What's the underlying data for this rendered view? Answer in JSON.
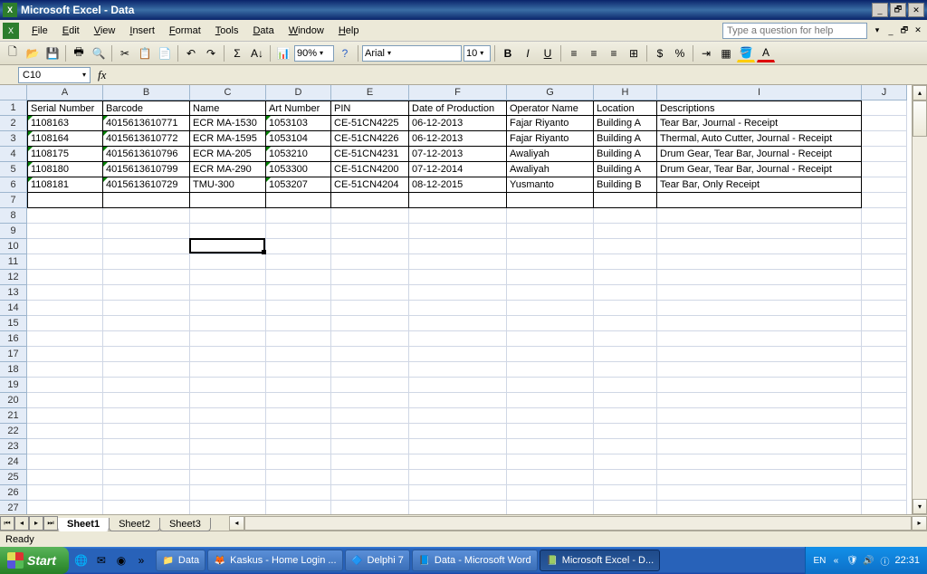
{
  "window": {
    "title": "Microsoft Excel - Data"
  },
  "menu": {
    "items": [
      "File",
      "Edit",
      "View",
      "Insert",
      "Format",
      "Tools",
      "Data",
      "Window",
      "Help"
    ],
    "help_placeholder": "Type a question for help"
  },
  "toolbar": {
    "zoom": "90%",
    "font": "Arial",
    "font_size": "10"
  },
  "namebox": {
    "value": "C10"
  },
  "formula": {
    "fx": "fx"
  },
  "columns": [
    "A",
    "B",
    "C",
    "D",
    "E",
    "F",
    "G",
    "H",
    "I",
    "J"
  ],
  "col_widths": [
    "c-A",
    "c-B",
    "c-C",
    "c-D",
    "c-E",
    "c-F",
    "c-G",
    "c-H",
    "c-I",
    "c-J"
  ],
  "row_count": 29,
  "active_cell": {
    "row": 10,
    "col": "C"
  },
  "headers": [
    "Serial Number",
    "Barcode",
    "Name",
    "Art Number",
    "PIN",
    "Date of Production",
    "Operator Name",
    "Location",
    "Descriptions"
  ],
  "rows": [
    [
      "1108163",
      "4015613610771",
      "ECR MA-1530",
      "1053103",
      "CE-51CN4225",
      "06-12-2013",
      "Fajar Riyanto",
      "Building A",
      "Tear Bar, Journal - Receipt"
    ],
    [
      "1108164",
      "4015613610772",
      "ECR MA-1595",
      "1053104",
      "CE-51CN4226",
      "06-12-2013",
      "Fajar Riyanto",
      "Building A",
      "Thermal, Auto Cutter, Journal - Receipt"
    ],
    [
      "1108175",
      "4015613610796",
      "ECR MA-205",
      "1053210",
      "CE-51CN4231",
      "07-12-2013",
      "Awaliyah",
      "Building A",
      "Drum Gear, Tear Bar, Journal - Receipt"
    ],
    [
      "1108180",
      "4015613610799",
      "ECR MA-290",
      "1053300",
      "CE-51CN4200",
      "07-12-2014",
      "Awaliyah",
      "Building A",
      "Drum Gear, Tear Bar, Journal - Receipt"
    ],
    [
      "1108181",
      "4015613610729",
      "TMU-300",
      "1053207",
      "CE-51CN4204",
      "08-12-2015",
      "Yusmanto",
      "Building B",
      "Tear Bar, Only Receipt"
    ]
  ],
  "sheets": {
    "tabs": [
      "Sheet1",
      "Sheet2",
      "Sheet3"
    ],
    "active": 0
  },
  "status": {
    "text": "Ready"
  },
  "taskbar": {
    "start": "Start",
    "items": [
      {
        "icon": "📁",
        "label": "Data"
      },
      {
        "icon": "🦊",
        "label": "Kaskus - Home Login ..."
      },
      {
        "icon": "🔷",
        "label": "Delphi 7"
      },
      {
        "icon": "📘",
        "label": "Data - Microsoft Word"
      },
      {
        "icon": "📗",
        "label": "Microsoft Excel - D...",
        "active": true
      }
    ],
    "tray": {
      "lang": "EN",
      "time": "22:31"
    }
  }
}
